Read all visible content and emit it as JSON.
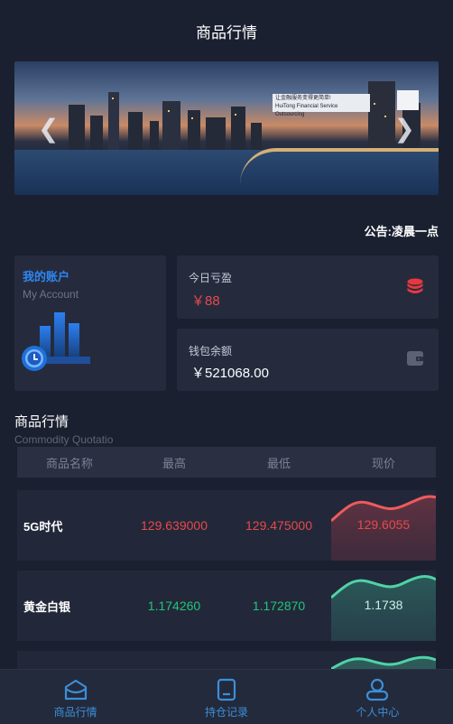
{
  "header": {
    "title": "商品行情"
  },
  "banner": {
    "sign_line1": "让金融服务变得更简单!",
    "sign_line2": "HuiTong Financial Service Outsourcing",
    "prev_icon": "chevron-left-icon",
    "next_icon": "chevron-right-icon"
  },
  "notice": {
    "text": "公告:凌晨一点"
  },
  "account": {
    "title": "我的账户",
    "subtitle": "My Account"
  },
  "today_profit": {
    "label": "今日亏盈",
    "value": "￥88",
    "icon": "coins-stack-icon",
    "color": "#e8494b"
  },
  "wallet": {
    "label": "钱包余额",
    "value": "￥521068.00",
    "icon": "wallet-icon"
  },
  "market": {
    "title": "商品行情",
    "subtitle": "Commodity Quotatio",
    "columns": [
      "商品名称",
      "最高",
      "最低",
      "现价"
    ],
    "rows": [
      {
        "name": "5G时代",
        "high": "129.639000",
        "low": "129.475000",
        "price": "129.6055",
        "trend": "up",
        "color": "#e8494b"
      },
      {
        "name": "黄金白银",
        "high": "1.174260",
        "low": "1.172870",
        "price": "1.1738",
        "trend": "down",
        "color": "#22c47a"
      }
    ]
  },
  "tabbar": {
    "items": [
      {
        "label": "商品行情",
        "icon": "market-icon"
      },
      {
        "label": "持仓记录",
        "icon": "record-icon"
      },
      {
        "label": "个人中心",
        "icon": "profile-icon"
      }
    ]
  }
}
